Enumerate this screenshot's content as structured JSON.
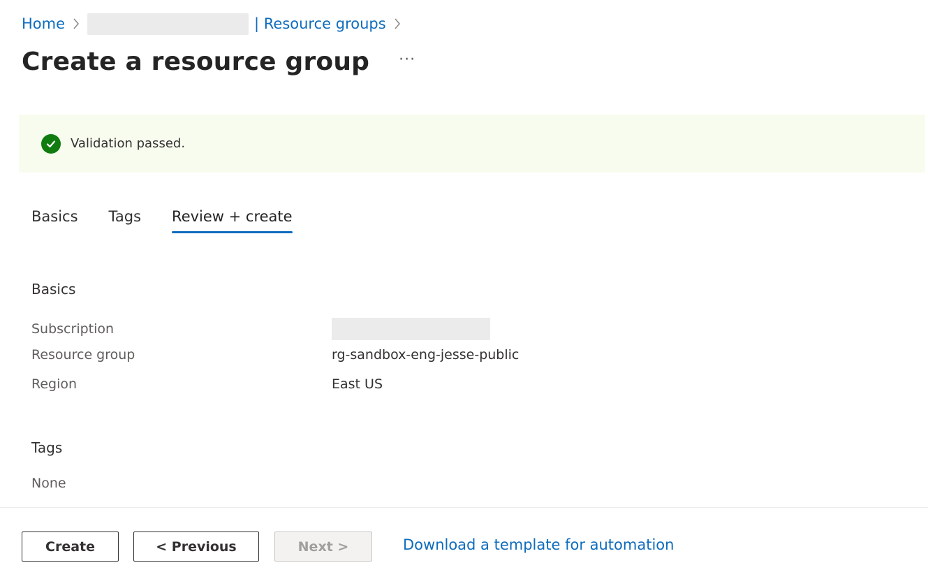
{
  "breadcrumb": {
    "home": "Home",
    "resource_groups": "| Resource groups",
    "separator": ">"
  },
  "page": {
    "title": "Create a resource group",
    "more_icon": "···"
  },
  "banner": {
    "icon": "check-circle-icon",
    "text": "Validation passed.",
    "status_color": "#107c10"
  },
  "tabs": [
    {
      "label": "Basics",
      "active": false
    },
    {
      "label": "Tags",
      "active": false
    },
    {
      "label": "Review + create",
      "active": true
    }
  ],
  "review": {
    "basics_heading": "Basics",
    "rows": [
      {
        "label": "Subscription",
        "value": ""
      },
      {
        "label": "Resource group",
        "value": "rg-sandbox-eng-jesse-public"
      },
      {
        "label": "Region",
        "value": "East US"
      }
    ],
    "tags_heading": "Tags",
    "tags_value": "None"
  },
  "footer": {
    "create_label": "Create",
    "previous_label": "< Previous",
    "next_label": "Next >",
    "download_link": "Download a template for automation"
  },
  "colors": {
    "accent": "#0f6cbd",
    "banner_bg": "#f7fcef"
  }
}
